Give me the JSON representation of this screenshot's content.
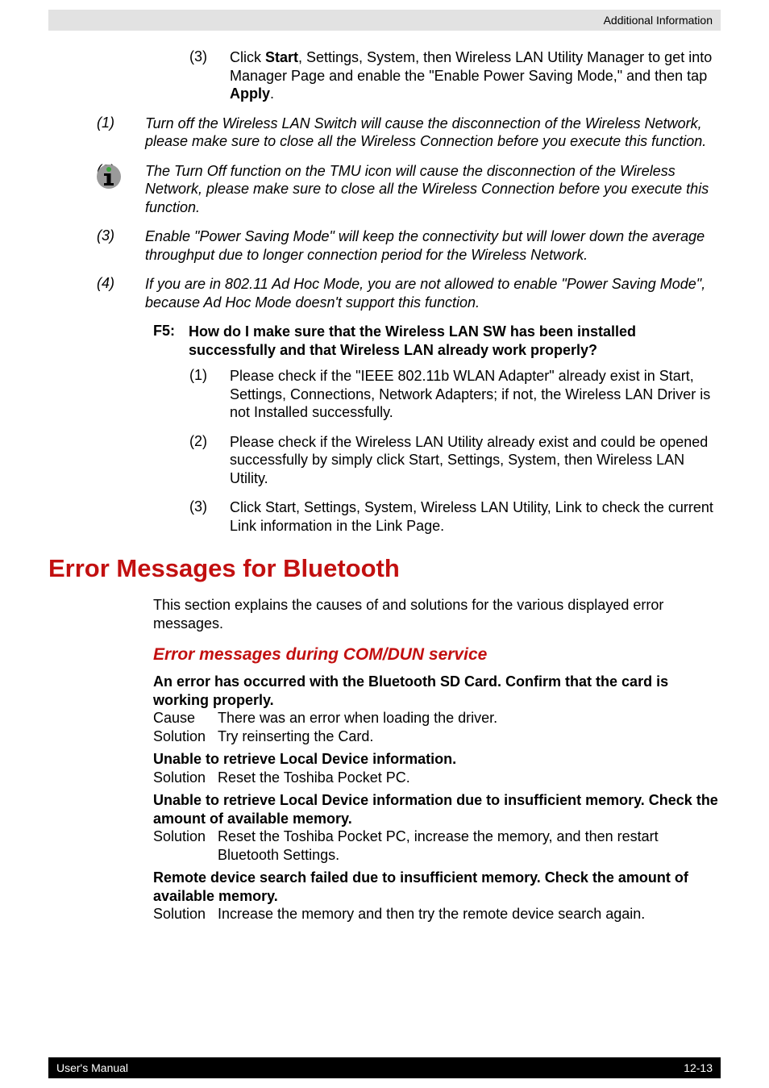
{
  "header": {
    "title": "Additional Information"
  },
  "intro_list": {
    "num": "(3)",
    "text_parts": [
      "Click ",
      "Start",
      ", Settings, System, then Wireless LAN Utility Manager to get into Manager Page and enable the \"Enable Power Saving Mode,\" and then tap ",
      "Apply",
      "."
    ]
  },
  "notes": [
    {
      "num": "(1)",
      "text": "Turn off the Wireless LAN Switch will cause the disconnection of the Wireless Network, please make sure to close all the Wireless Connection before you execute this function."
    },
    {
      "num": "(2)",
      "text": "The Turn Off function on the TMU icon will cause the disconnection of the Wireless Network, please make sure to close all the Wireless Connection before you execute this function."
    },
    {
      "num": "(3)",
      "text": "Enable \"Power Saving Mode\" will keep the connectivity but will lower down the average throughput due to longer connection period for the Wireless Network."
    },
    {
      "num": "(4)",
      "text": "If you are in 802.11 Ad Hoc Mode, you are not allowed to enable \"Power Saving Mode\", because Ad Hoc Mode doesn't support this function."
    }
  ],
  "faq": {
    "label": "F5:",
    "question": "How do I make sure that the Wireless LAN SW has been installed successfully and that Wireless LAN already work properly?",
    "answers": [
      {
        "num": "(1)",
        "text": "Please check if the \"IEEE 802.11b WLAN Adapter\" already exist in Start, Settings, Connections, Network Adapters; if not, the Wireless LAN Driver is not Installed successfully."
      },
      {
        "num": "(2)",
        "text": "Please check if the Wireless LAN Utility already exist and could be opened successfully by simply click Start, Settings, System, then Wireless LAN Utility."
      },
      {
        "num": "(3)",
        "text": "Click Start, Settings, System, Wireless LAN Utility, Link to check the current Link information in the Link Page."
      }
    ]
  },
  "section": {
    "h1": "Error Messages for Bluetooth",
    "intro": "This section explains the causes of and solutions for the various displayed error messages.",
    "h2": "Error messages during COM/DUN service",
    "errors": [
      {
        "title": "An error has occurred with the Bluetooth SD Card. Confirm that the card is working properly.",
        "rows": [
          {
            "k": "Cause",
            "v": "There was an error when loading the driver."
          },
          {
            "k": "Solution",
            "v": "Try reinserting the Card."
          }
        ]
      },
      {
        "title": "Unable to retrieve Local Device information.",
        "rows": [
          {
            "k": "Solution",
            "v": "Reset the Toshiba Pocket PC."
          }
        ]
      },
      {
        "title": "Unable to retrieve Local Device information due to insufficient memory. Check the amount of available memory.",
        "rows": [
          {
            "k": "Solution",
            "v": "Reset the Toshiba Pocket PC, increase the memory, and then restart Bluetooth Settings."
          }
        ]
      },
      {
        "title": "Remote device search failed due to insufficient memory. Check the amount of available memory.",
        "rows": [
          {
            "k": "Solution",
            "v": "Increase the memory and then try the remote device search again."
          }
        ]
      }
    ]
  },
  "footer": {
    "left": "User's Manual",
    "right": "12-13"
  }
}
